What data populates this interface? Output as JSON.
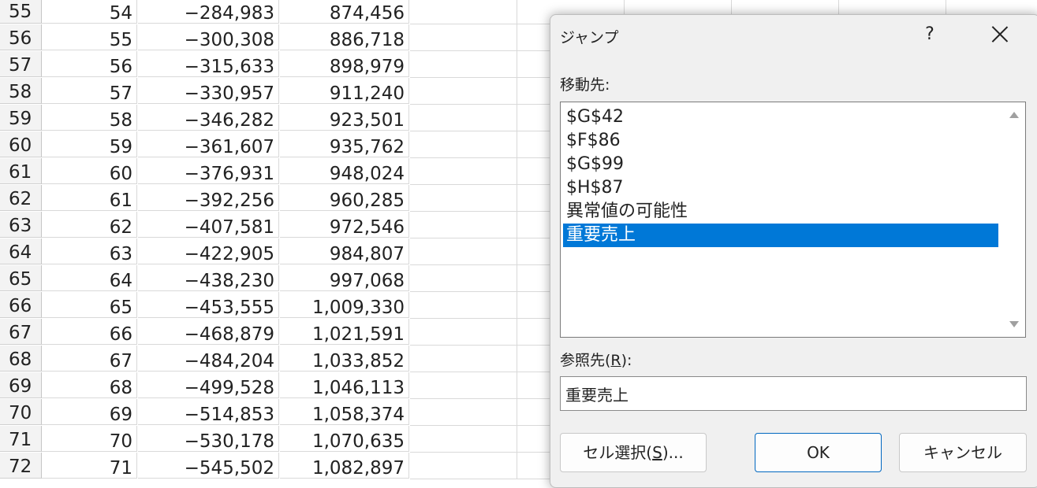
{
  "sheet": {
    "rows": [
      {
        "n": "55",
        "a": "54",
        "b": "−284,983",
        "c": "874,456"
      },
      {
        "n": "56",
        "a": "55",
        "b": "−300,308",
        "c": "886,718"
      },
      {
        "n": "57",
        "a": "56",
        "b": "−315,633",
        "c": "898,979"
      },
      {
        "n": "58",
        "a": "57",
        "b": "−330,957",
        "c": "911,240"
      },
      {
        "n": "59",
        "a": "58",
        "b": "−346,282",
        "c": "923,501"
      },
      {
        "n": "60",
        "a": "59",
        "b": "−361,607",
        "c": "935,762"
      },
      {
        "n": "61",
        "a": "60",
        "b": "−376,931",
        "c": "948,024"
      },
      {
        "n": "62",
        "a": "61",
        "b": "−392,256",
        "c": "960,285"
      },
      {
        "n": "63",
        "a": "62",
        "b": "−407,581",
        "c": "972,546"
      },
      {
        "n": "64",
        "a": "63",
        "b": "−422,905",
        "c": "984,807"
      },
      {
        "n": "65",
        "a": "64",
        "b": "−438,230",
        "c": "997,068"
      },
      {
        "n": "66",
        "a": "65",
        "b": "−453,555",
        "c": "1,009,330"
      },
      {
        "n": "67",
        "a": "66",
        "b": "−468,879",
        "c": "1,021,591"
      },
      {
        "n": "68",
        "a": "67",
        "b": "−484,204",
        "c": "1,033,852"
      },
      {
        "n": "69",
        "a": "68",
        "b": "−499,528",
        "c": "1,046,113"
      },
      {
        "n": "70",
        "a": "69",
        "b": "−514,853",
        "c": "1,058,374"
      },
      {
        "n": "71",
        "a": "70",
        "b": "−530,178",
        "c": "1,070,635"
      },
      {
        "n": "72",
        "a": "71",
        "b": "−545,502",
        "c": "1,082,897"
      }
    ]
  },
  "dialog": {
    "title": "ジャンプ",
    "help_icon": "?",
    "close_icon": "close-icon",
    "goto_label": "移動先:",
    "goto_items": [
      {
        "label": "$G$42",
        "selected": false
      },
      {
        "label": "$F$86",
        "selected": false
      },
      {
        "label": "$G$99",
        "selected": false
      },
      {
        "label": "$H$87",
        "selected": false
      },
      {
        "label": "異常値の可能性",
        "selected": false
      },
      {
        "label": "重要売上",
        "selected": true
      }
    ],
    "ref_label_pre": "参照先(",
    "ref_label_key": "R",
    "ref_label_post": "):",
    "ref_value": "重要売上",
    "special_button": {
      "pre": "セル選択(",
      "key": "S",
      "post": ")..."
    },
    "ok_button": "OK",
    "cancel_button": "キャンセル",
    "colors": {
      "selection": "#0078d7",
      "ok_border": "#0067c0"
    }
  }
}
